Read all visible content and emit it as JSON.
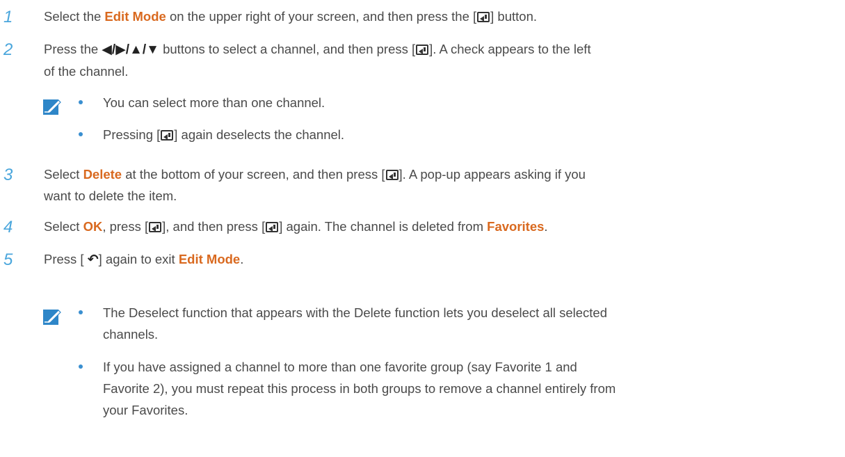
{
  "glyphs": {
    "arrows": "◀/▶/▲/▼",
    "return": "↶"
  },
  "steps": [
    {
      "num": "1",
      "a": "Select the ",
      "b": "Edit Mode",
      "c": " on the upper right of your screen, and then press the [",
      "d": "] button."
    },
    {
      "num": "2",
      "a": "Press the ",
      "b": " buttons to select a channel, and then press [",
      "c": "]. A check appears to the left",
      "d": "of the channel."
    },
    {
      "num": "3",
      "a": "Select ",
      "b": "Delete",
      "c": " at the bottom of your screen, and then press [",
      "d": "]. A pop-up appears asking if you",
      "e": "want to delete the item."
    },
    {
      "num": "4",
      "a": "Select ",
      "b": "OK",
      "c": ", press [",
      "d": "], and then press [",
      "e": "] again. The channel is deleted from ",
      "f": "Favorites",
      "g": "."
    },
    {
      "num": "5",
      "a": "Press [ ",
      "b": "] again to exit ",
      "c": "Edit Mode",
      "d": "."
    }
  ],
  "note1": {
    "bullet1": "You can select more than one channel.",
    "bullet2_a": "Pressing [",
    "bullet2_b": "] again deselects the channel."
  },
  "note2": {
    "bullet1_line1": "The Deselect function that appears with the Delete function lets you deselect all selected",
    "bullet1_line2": "channels.",
    "bullet2_line1": "If you have assigned a channel to more than one favorite group (say Favorite 1 and",
    "bullet2_line2": "Favorite 2), you must repeat this process in both groups to remove a channel entirely from",
    "bullet2_line3": "your Favorites."
  },
  "colors": {
    "accent_orange": "#d9691f",
    "step_number_blue": "#4aa6dc",
    "bullet_blue": "#3a8fd0",
    "note_icon_blue": "#2e86c8",
    "body_text": "#4a4a4a"
  }
}
